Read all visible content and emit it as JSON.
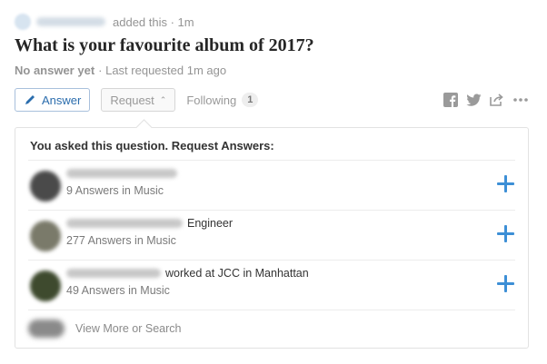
{
  "question": {
    "added_text": "added this · 1m",
    "title": "What is your favourite album of 2017?",
    "no_answer": "No answer yet",
    "last_requested": "· Last requested 1m ago"
  },
  "actions": {
    "answer_label": "Answer",
    "request_label": "Request",
    "following_label": "Following",
    "following_count": "1",
    "share_icons": [
      "facebook-icon",
      "twitter-icon",
      "share-icon",
      "more-icon"
    ]
  },
  "request_panel": {
    "header": "You asked this question. Request Answers:",
    "people": [
      {
        "avatar_color": "#4a4a4a",
        "credential": "",
        "answers": "9 Answers in Music"
      },
      {
        "avatar_color": "#7a7a6a",
        "credential": "Engineer",
        "answers": "277 Answers in Music"
      },
      {
        "avatar_color": "#3e4a2e",
        "credential": "worked at JCC in Manhattan",
        "answers": "49 Answers in Music"
      }
    ],
    "view_more": "View More or Search"
  },
  "colors": {
    "accent": "#2b6dad",
    "plus": "#3d8fd6"
  }
}
